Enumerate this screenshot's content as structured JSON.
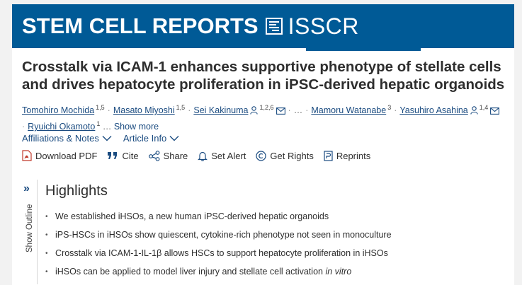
{
  "banner": {
    "brand": "STEM CELL REPORTS",
    "partner": "ISSCR",
    "color": "#005a96"
  },
  "article": {
    "title": "Crosstalk via ICAM-1 enhances supportive phenotype of stellate cells and drives hepatocyte proliferation in iPSC-derived hepatic organoids"
  },
  "authors": [
    {
      "name": "Tomohiro Mochida",
      "sup": "1,5",
      "person_icon": false,
      "mail_icon": false
    },
    {
      "name": "Masato Miyoshi",
      "sup": "1,5",
      "person_icon": false,
      "mail_icon": false
    },
    {
      "name": "Sei Kakinuma",
      "sup": "1,2,6",
      "person_icon": true,
      "mail_icon": true
    },
    {
      "name": "Mamoru Watanabe",
      "sup": "3",
      "person_icon": false,
      "mail_icon": false
    },
    {
      "name": "Yasuhiro Asahina",
      "sup": "1,4",
      "person_icon": true,
      "mail_icon": true
    },
    {
      "name": "Ryuichi Okamoto",
      "sup": "1",
      "person_icon": false,
      "mail_icon": false
    }
  ],
  "authors_ellipsis": "…",
  "authors_trailing": "…",
  "show_more": "Show more",
  "info": {
    "affiliations": "Affiliations & Notes",
    "article_info": "Article Info"
  },
  "toolbar": {
    "download_pdf": "Download PDF",
    "cite": "Cite",
    "share": "Share",
    "set_alert": "Set Alert",
    "get_rights": "Get Rights",
    "reprints": "Reprints"
  },
  "sidebar": {
    "label": "Show Outline"
  },
  "highlights": {
    "heading": "Highlights",
    "items": [
      "We established iHSOs, a new human iPSC-derived hepatic organoids",
      "iPS-HSCs in iHSOs show quiescent, cytokine-rich phenotype not seen in monoculture",
      "Crosstalk via ICAM-1-IL-1β allows HSCs to support hepatocyte proliferation in iHSOs",
      "iHSOs can be applied to model liver injury and stellate cell activation"
    ],
    "last_item_suffix": "in vitro"
  }
}
